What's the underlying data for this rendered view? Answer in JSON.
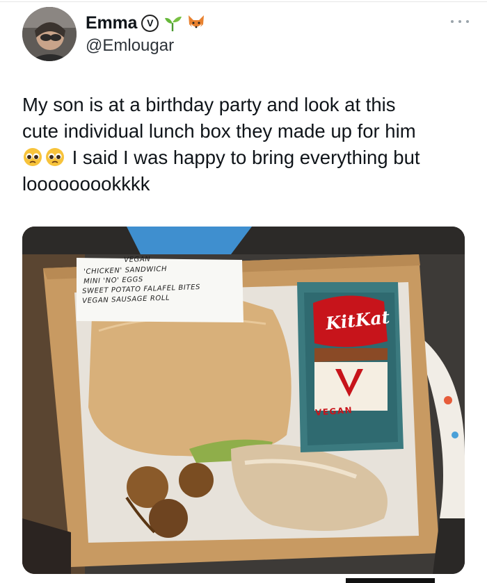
{
  "tweet": {
    "author": {
      "display_name": "Emma",
      "verified_symbol": "V",
      "name_emojis": [
        "seedling-icon",
        "fox-icon"
      ],
      "handle": "@Emlougar",
      "avatar": "avatar"
    },
    "menu_icon": "more-icon",
    "text": {
      "line1": "My son is at a birthday party and look at this",
      "line2": "cute individual lunch box they made up for him",
      "line3_emojis": [
        "pleading-face-icon",
        "pleading-face-icon"
      ],
      "line3": "I said I was happy to bring everything but",
      "line4": "looooooookkkk"
    },
    "photo": {
      "sticker": {
        "line1": "VEGAN",
        "line2": "'CHICKEN' SANDWICH",
        "line3": "MINI 'NO' EGGS",
        "line4": "SWEET POTATO FALAFEL BITES",
        "line5": "VEGAN SAUSAGE ROLL"
      },
      "chocolate_brand": "KitKat",
      "chocolate_label": "VEGAN"
    }
  },
  "colors": {
    "text": "#0f1419",
    "handle": "#2d3339",
    "kitkat_red": "#c7141b",
    "box_kraft": "#c89a62"
  }
}
